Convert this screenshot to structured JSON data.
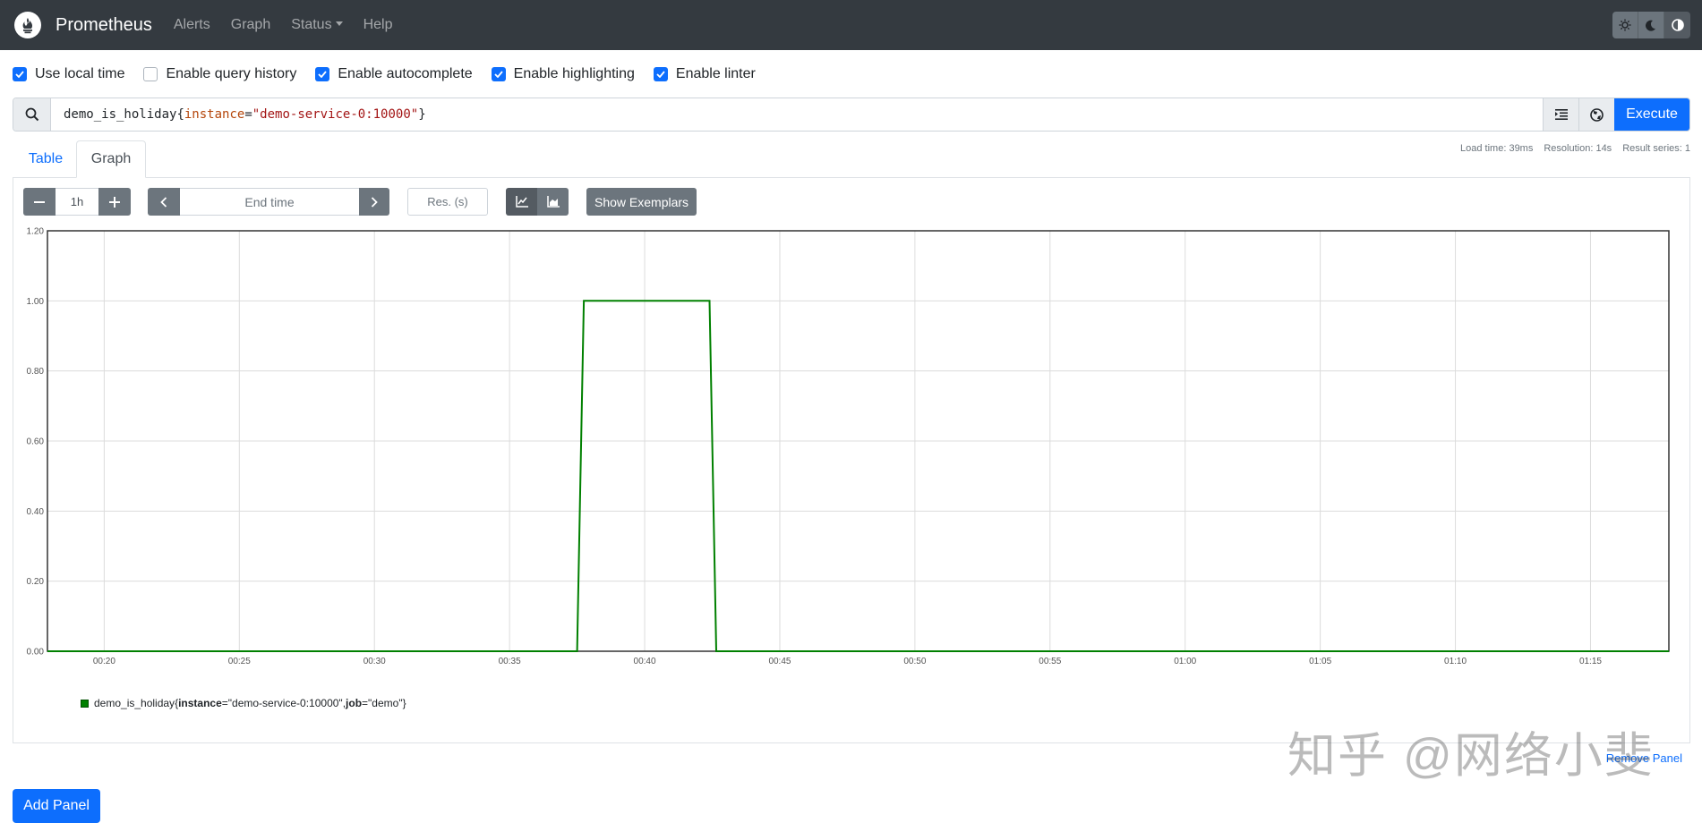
{
  "navbar": {
    "brand": "Prometheus",
    "links": [
      "Alerts",
      "Graph",
      "Status",
      "Help"
    ],
    "theme_buttons": [
      "light-theme-icon",
      "dark-theme-icon",
      "browser-theme-icon"
    ]
  },
  "options": [
    {
      "label": "Use local time",
      "checked": true
    },
    {
      "label": "Enable query history",
      "checked": false
    },
    {
      "label": "Enable autocomplete",
      "checked": true
    },
    {
      "label": "Enable highlighting",
      "checked": true
    },
    {
      "label": "Enable linter",
      "checked": true
    }
  ],
  "query": {
    "metric": "demo_is_holiday",
    "open": "{",
    "label": "instance",
    "eq": "=",
    "value": "\"demo-service-0:10000\"",
    "close": "}",
    "execute_label": "Execute"
  },
  "stats": {
    "load_time": "Load time: 39ms",
    "resolution": "Resolution: 14s",
    "result_series": "Result series: 1"
  },
  "tabs": {
    "table": "Table",
    "graph": "Graph"
  },
  "controls": {
    "range": "1h",
    "end_time_placeholder": "End time",
    "res_placeholder": "Res. (s)",
    "show_exemplars": "Show Exemplars"
  },
  "chart_data": {
    "type": "line",
    "title": "",
    "xlabel": "",
    "ylabel": "",
    "ylim": [
      0,
      1.2
    ],
    "y_ticks": [
      "0.00",
      "0.20",
      "0.40",
      "0.60",
      "0.80",
      "1.00",
      "1.20"
    ],
    "x_ticks": [
      "00:20",
      "00:25",
      "00:30",
      "00:35",
      "00:40",
      "00:45",
      "00:50",
      "00:55",
      "01:00",
      "01:05",
      "01:10",
      "01:15"
    ],
    "x_range_minutes": [
      17.9,
      77.9
    ],
    "grid": true,
    "color": "#008000",
    "series": [
      {
        "name": "demo_is_holiday{instance=\"demo-service-0:10000\", job=\"demo\"}",
        "points_minutes": [
          [
            17.9,
            0
          ],
          [
            37.5,
            0
          ],
          [
            37.75,
            1
          ],
          [
            42.4,
            1
          ],
          [
            42.65,
            0
          ],
          [
            77.9,
            0
          ]
        ]
      }
    ]
  },
  "legend": {
    "metric": "demo_is_holiday",
    "open": "{",
    "label1": "instance",
    "value1": "=\"demo-service-0:10000\", ",
    "label2": "job",
    "value2": "=\"demo\"}"
  },
  "remove_panel": "Remove Panel",
  "add_panel": "Add Panel",
  "watermark": "知乎 @网络小斐"
}
